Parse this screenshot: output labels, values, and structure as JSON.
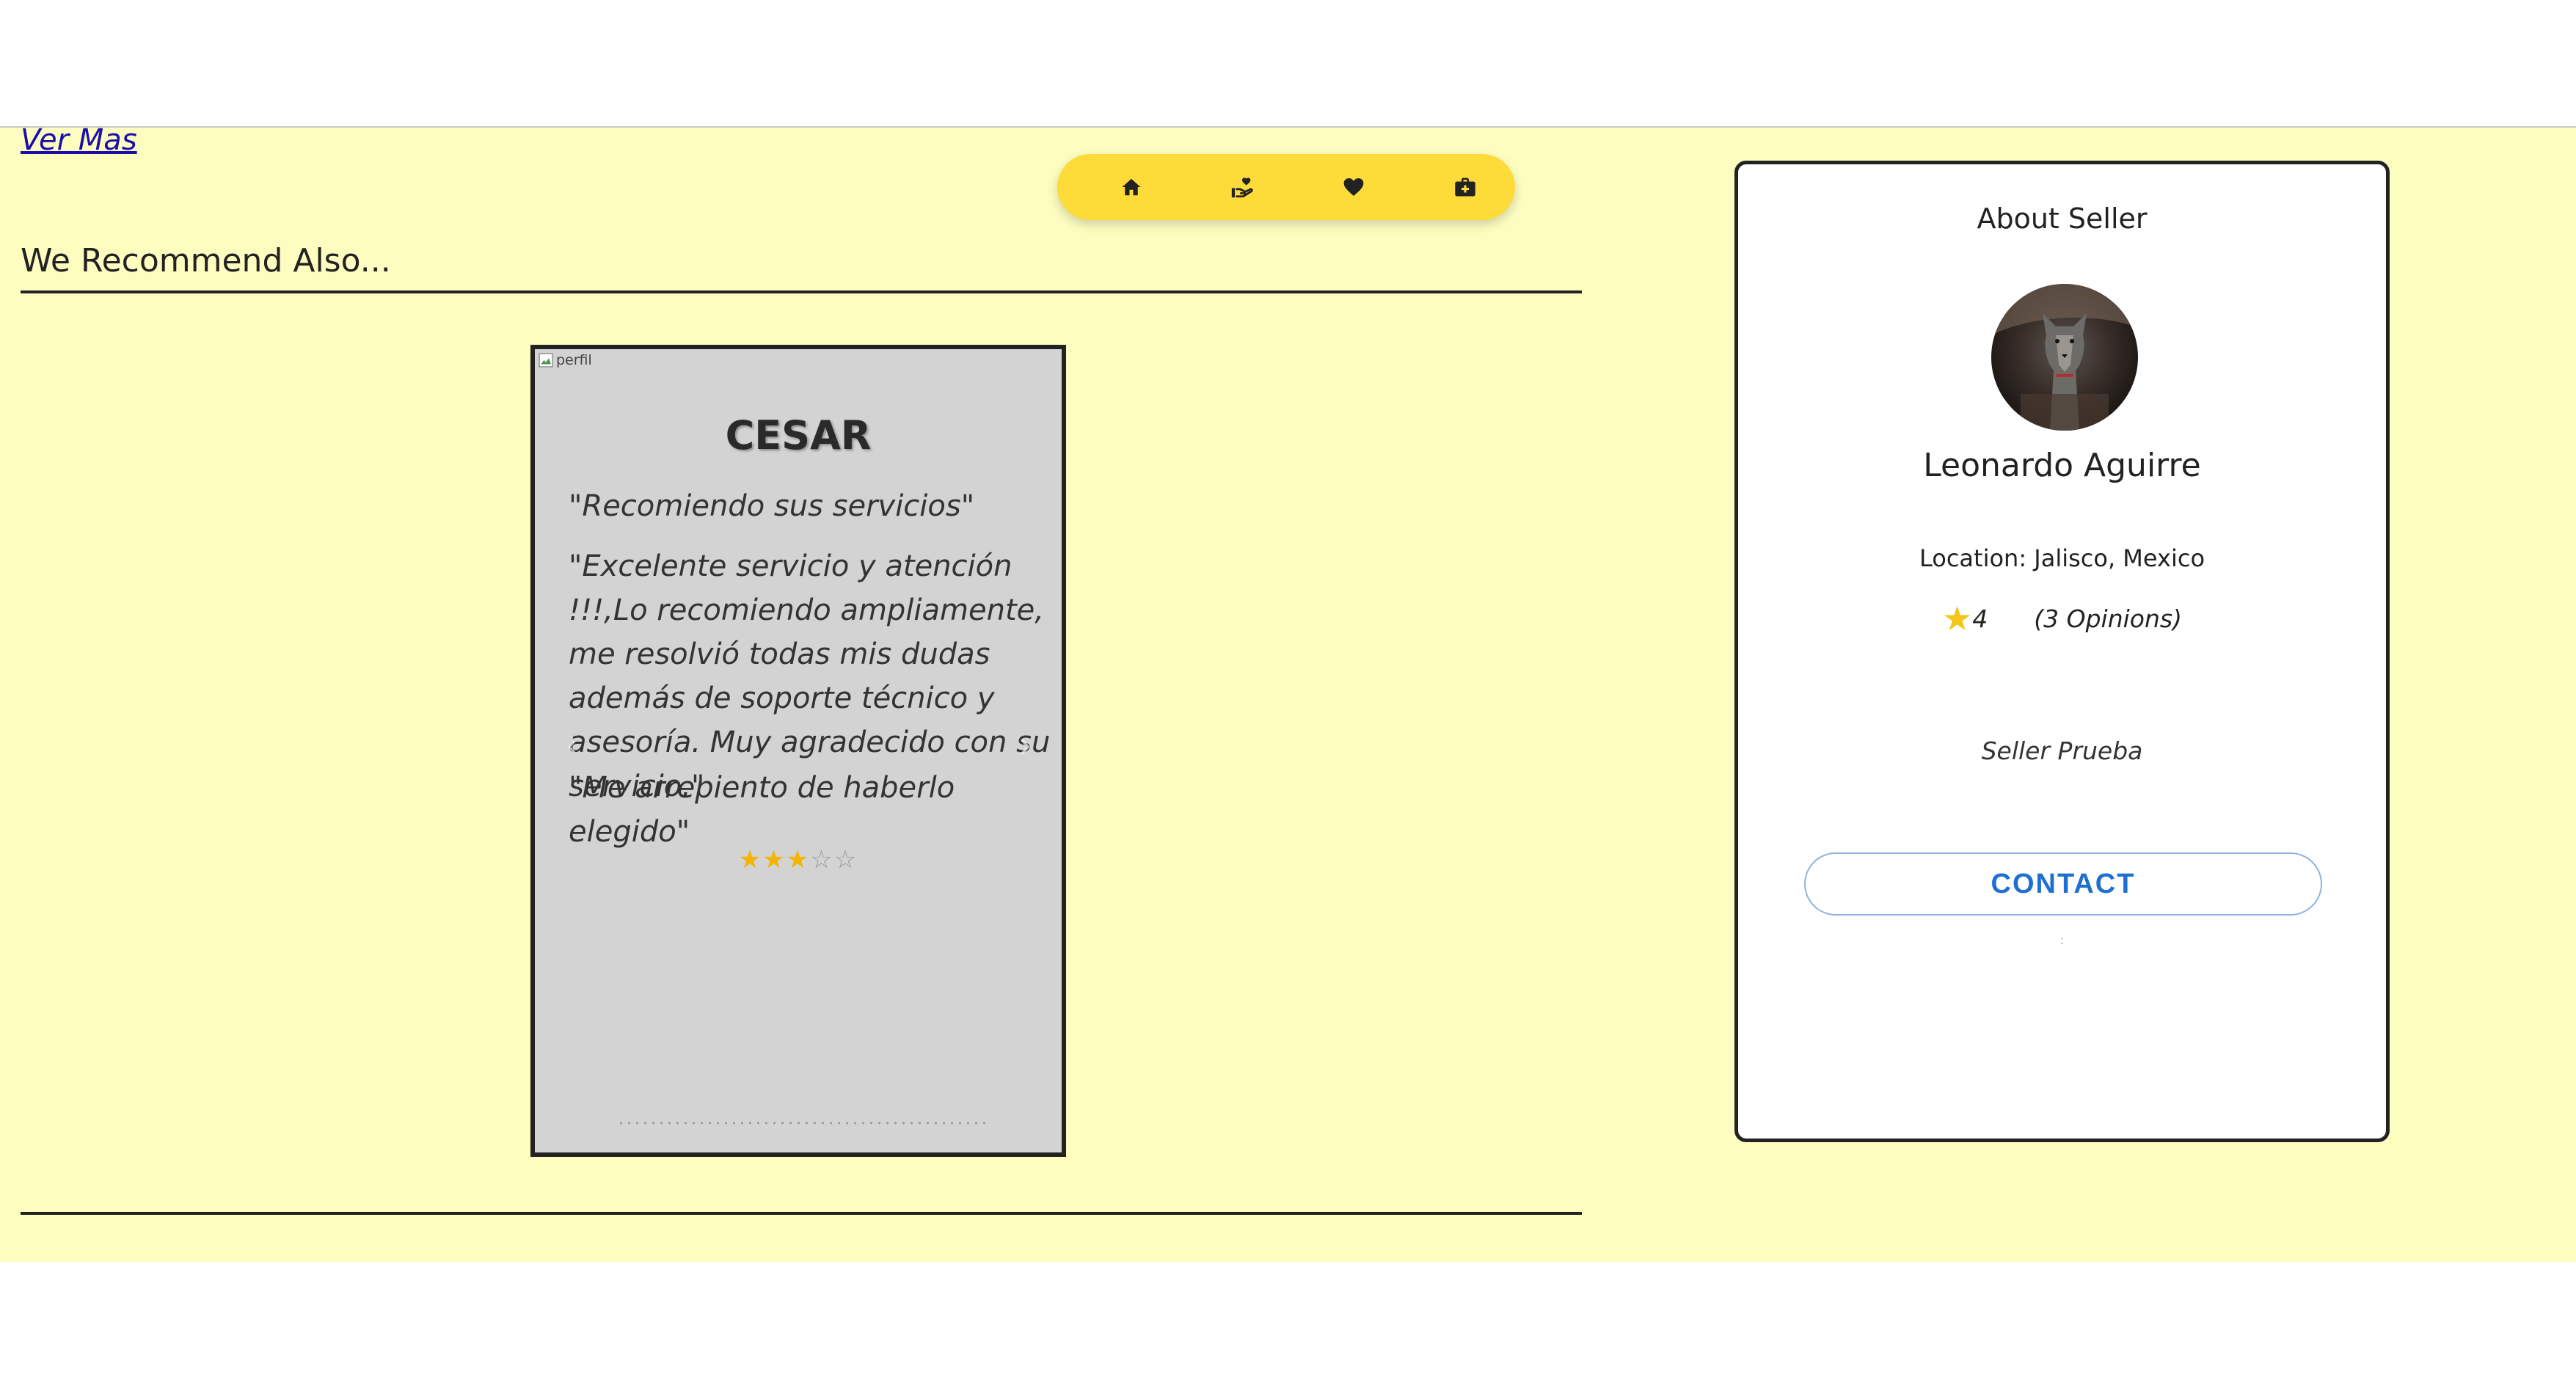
{
  "links": {
    "ver_mas": "Ver Mas"
  },
  "nav": {
    "icons": [
      "home-icon",
      "hand-heart-icon",
      "heart-icon",
      "briefcase-icon"
    ],
    "color": "#fddc3a"
  },
  "recommend": {
    "title": "We Recommend Also..."
  },
  "review": {
    "image_alt": "perfil",
    "name": "CESAR",
    "quotes": [
      "\"Recomiendo sus servicios\"",
      "\"Excelente servicio y atención !!!,Lo recomiendo ampliamente, me resolvió todas mis dudas además de soporte técnico y asesoría. Muy agradecido con su servicio.\"",
      "\"Me arrepiento de haberlo elegido\""
    ],
    "stars_filled": 3,
    "stars_total": 5,
    "star_color": "#f5b400"
  },
  "seller": {
    "heading": "About Seller",
    "name": "Leonardo Aguirre",
    "location": "Location: Jalisco, Mexico",
    "rating": "4",
    "opinions": "(3 Opinions)",
    "description": "Seller Prueba",
    "contact_label": "CONTACT",
    "accent_color": "#1f6fd1"
  }
}
